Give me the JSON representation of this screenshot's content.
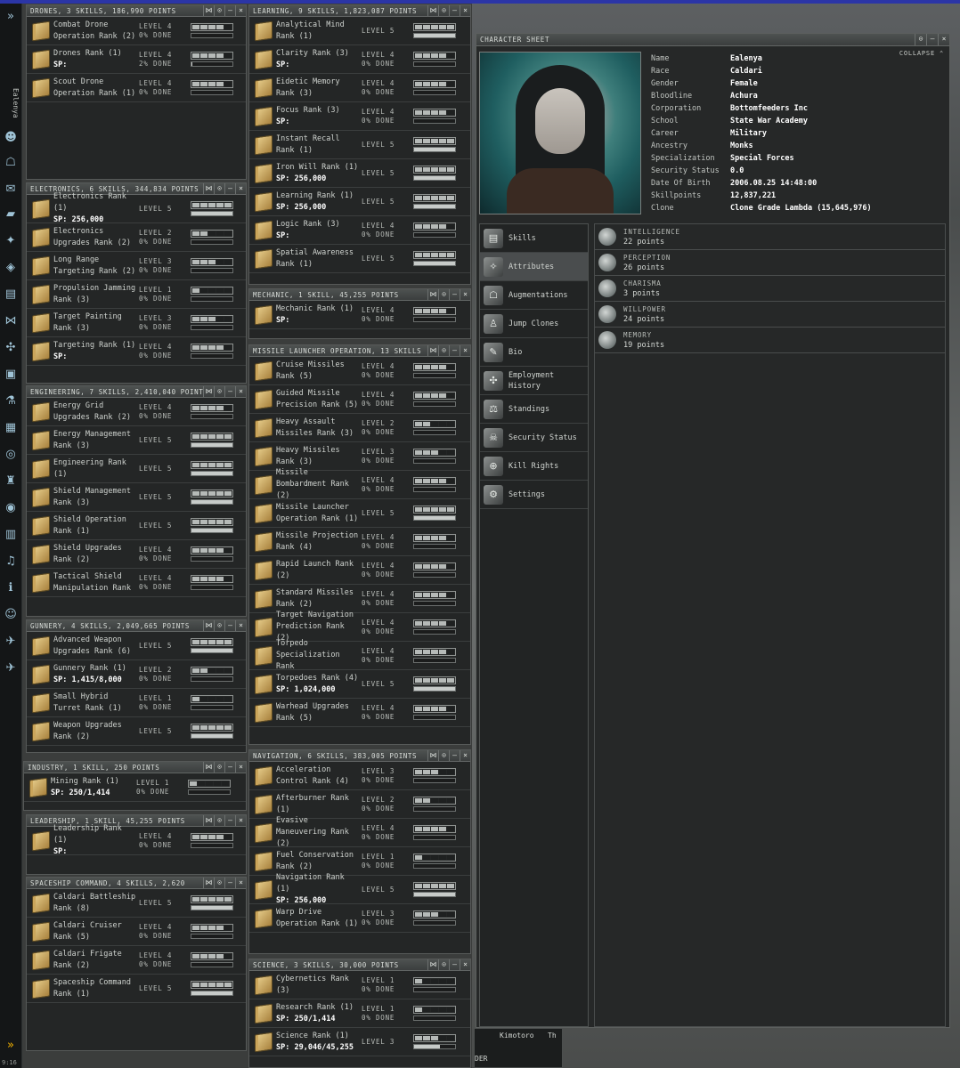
{
  "neocom": {
    "character": "Ealenya",
    "clock": "9:16"
  },
  "panels": [
    {
      "id": "drones",
      "title": "DRONES, 3 SKILLS, 186,990 POINTS",
      "skills": [
        {
          "name": "Combat Drone Operation Rank (2)",
          "level": "LEVEL 4",
          "done": "0% DONE",
          "lvl": 4,
          "pct": 0
        },
        {
          "name": "Drones Rank (1)",
          "sp": "SP:",
          "level": "LEVEL 4",
          "done": "2% DONE",
          "lvl": 4,
          "pct": 2
        },
        {
          "name": "Scout Drone Operation Rank (1)",
          "level": "LEVEL 4",
          "done": "0% DONE",
          "lvl": 4,
          "pct": 0
        }
      ]
    },
    {
      "id": "electronics",
      "title": "ELECTRONICS, 6 SKILLS, 344,834 POINTS",
      "skills": [
        {
          "name": "Electronics Rank (1)",
          "sp": "SP: 256,000",
          "level": "LEVEL 5",
          "lvl": 5,
          "pct": 100
        },
        {
          "name": "Electronics Upgrades Rank (2)",
          "level": "LEVEL 2",
          "done": "0% DONE",
          "lvl": 2,
          "pct": 0
        },
        {
          "name": "Long Range Targeting Rank (2)",
          "level": "LEVEL 3",
          "done": "0% DONE",
          "lvl": 3,
          "pct": 0
        },
        {
          "name": "Propulsion Jamming Rank (3)",
          "level": "LEVEL 1",
          "done": "0% DONE",
          "lvl": 1,
          "pct": 0
        },
        {
          "name": "Target Painting Rank (3)",
          "level": "LEVEL 3",
          "done": "0% DONE",
          "lvl": 3,
          "pct": 0
        },
        {
          "name": "Targeting Rank (1)",
          "sp": "SP:",
          "level": "LEVEL 4",
          "done": "0% DONE",
          "lvl": 4,
          "pct": 0
        }
      ]
    },
    {
      "id": "engineering",
      "title": "ENGINEERING, 7 SKILLS, 2,410,040 POINTS",
      "skills": [
        {
          "name": "Energy Grid Upgrades Rank (2)",
          "level": "LEVEL 4",
          "done": "0% DONE",
          "lvl": 4,
          "pct": 0
        },
        {
          "name": "Energy Management Rank (3)",
          "level": "LEVEL 5",
          "lvl": 5,
          "pct": 100
        },
        {
          "name": "Engineering Rank (1)",
          "level": "LEVEL 5",
          "lvl": 5,
          "pct": 100
        },
        {
          "name": "Shield Management Rank (3)",
          "level": "LEVEL 5",
          "lvl": 5,
          "pct": 100
        },
        {
          "name": "Shield Operation Rank (1)",
          "level": "LEVEL 5",
          "lvl": 5,
          "pct": 100
        },
        {
          "name": "Shield Upgrades Rank (2)",
          "level": "LEVEL 4",
          "done": "0% DONE",
          "lvl": 4,
          "pct": 0
        },
        {
          "name": "Tactical Shield Manipulation Rank",
          "level": "LEVEL 4",
          "done": "0% DONE",
          "lvl": 4,
          "pct": 0
        }
      ]
    },
    {
      "id": "gunnery",
      "title": "GUNNERY, 4 SKILLS, 2,049,665 POINTS",
      "skills": [
        {
          "name": "Advanced Weapon Upgrades Rank (6)",
          "level": "LEVEL 5",
          "lvl": 5,
          "pct": 100
        },
        {
          "name": "Gunnery Rank (1)",
          "sp": "SP: 1,415/8,000",
          "level": "LEVEL 2",
          "done": "0% DONE",
          "lvl": 2,
          "pct": 0
        },
        {
          "name": "Small Hybrid Turret Rank (1)",
          "level": "LEVEL 1",
          "done": "0% DONE",
          "lvl": 1,
          "pct": 0
        },
        {
          "name": "Weapon Upgrades Rank (2)",
          "level": "LEVEL 5",
          "lvl": 5,
          "pct": 100
        }
      ]
    },
    {
      "id": "industry",
      "title": "INDUSTRY, 1 SKILL, 250 POINTS",
      "skills": [
        {
          "name": "Mining Rank (1)",
          "sp": "SP: 250/1,414",
          "level": "LEVEL 1",
          "done": "0% DONE",
          "lvl": 1,
          "pct": 0
        }
      ]
    },
    {
      "id": "leadership",
      "title": "LEADERSHIP, 1 SKILL, 45,255 POINTS",
      "skills": [
        {
          "name": "Leadership Rank (1)",
          "sp": "SP:",
          "level": "LEVEL 4",
          "done": "0% DONE",
          "lvl": 4,
          "pct": 0
        }
      ]
    },
    {
      "id": "spaceship",
      "title": "SPACESHIP COMMAND, 4 SKILLS, 2,620",
      "skills": [
        {
          "name": "Caldari Battleship Rank (8)",
          "level": "LEVEL 5",
          "lvl": 5,
          "pct": 100
        },
        {
          "name": "Caldari Cruiser Rank (5)",
          "level": "LEVEL 4",
          "done": "0% DONE",
          "lvl": 4,
          "pct": 0
        },
        {
          "name": "Caldari Frigate Rank (2)",
          "level": "LEVEL 4",
          "done": "0% DONE",
          "lvl": 4,
          "pct": 0
        },
        {
          "name": "Spaceship Command Rank (1)",
          "level": "LEVEL 5",
          "lvl": 5,
          "pct": 100
        }
      ]
    },
    {
      "id": "learning",
      "title": "LEARNING, 9 SKILLS, 1,823,087 POINTS",
      "skills": [
        {
          "name": "Analytical Mind Rank (1)",
          "level": "LEVEL 5",
          "lvl": 5,
          "pct": 100
        },
        {
          "name": "Clarity Rank (3)",
          "sp": "SP:",
          "level": "LEVEL 4",
          "done": "0% DONE",
          "lvl": 4,
          "pct": 0
        },
        {
          "name": "Eidetic Memory Rank (3)",
          "level": "LEVEL 4",
          "done": "0% DONE",
          "lvl": 4,
          "pct": 0
        },
        {
          "name": "Focus Rank (3)",
          "sp": "SP:",
          "level": "LEVEL 4",
          "done": "0% DONE",
          "lvl": 4,
          "pct": 0
        },
        {
          "name": "Instant Recall Rank (1)",
          "level": "LEVEL 5",
          "lvl": 5,
          "pct": 100
        },
        {
          "name": "Iron Will Rank (1)",
          "sp": "SP: 256,000",
          "level": "LEVEL 5",
          "lvl": 5,
          "pct": 100
        },
        {
          "name": "Learning Rank (1)",
          "sp": "SP: 256,000",
          "level": "LEVEL 5",
          "lvl": 5,
          "pct": 100
        },
        {
          "name": "Logic Rank (3)",
          "sp": "SP:",
          "level": "LEVEL 4",
          "done": "0% DONE",
          "lvl": 4,
          "pct": 0
        },
        {
          "name": "Spatial Awareness Rank (1)",
          "level": "LEVEL 5",
          "lvl": 5,
          "pct": 100
        }
      ]
    },
    {
      "id": "mechanic",
      "title": "MECHANIC, 1 SKILL, 45,255 POINTS",
      "skills": [
        {
          "name": "Mechanic Rank (1)",
          "sp": "SP:",
          "level": "LEVEL 4",
          "done": "0% DONE",
          "lvl": 4,
          "pct": 0
        }
      ]
    },
    {
      "id": "missile",
      "title": "MISSILE LAUNCHER OPERATION, 13 SKILLS",
      "skills": [
        {
          "name": "Cruise Missiles Rank (5)",
          "level": "LEVEL 4",
          "done": "0% DONE",
          "lvl": 4,
          "pct": 0
        },
        {
          "name": "Guided Missile Precision Rank (5)",
          "level": "LEVEL 4",
          "done": "0% DONE",
          "lvl": 4,
          "pct": 0
        },
        {
          "name": "Heavy Assault Missiles Rank (3)",
          "level": "LEVEL 2",
          "done": "0% DONE",
          "lvl": 2,
          "pct": 0
        },
        {
          "name": "Heavy Missiles Rank (3)",
          "level": "LEVEL 3",
          "done": "0% DONE",
          "lvl": 3,
          "pct": 0
        },
        {
          "name": "Missile Bombardment Rank (2)",
          "level": "LEVEL 4",
          "done": "0% DONE",
          "lvl": 4,
          "pct": 0
        },
        {
          "name": "Missile Launcher Operation Rank (1)",
          "level": "LEVEL 5",
          "lvl": 5,
          "pct": 100
        },
        {
          "name": "Missile Projection Rank (4)",
          "level": "LEVEL 4",
          "done": "0% DONE",
          "lvl": 4,
          "pct": 0
        },
        {
          "name": "Rapid Launch Rank (2)",
          "level": "LEVEL 4",
          "done": "0% DONE",
          "lvl": 4,
          "pct": 0
        },
        {
          "name": "Standard Missiles Rank (2)",
          "level": "LEVEL 4",
          "done": "0% DONE",
          "lvl": 4,
          "pct": 0
        },
        {
          "name": "Target Navigation Prediction Rank (2)",
          "level": "LEVEL 4",
          "done": "0% DONE",
          "lvl": 4,
          "pct": 0
        },
        {
          "name": "Torpedo Specialization Rank",
          "level": "LEVEL 4",
          "done": "0% DONE",
          "lvl": 4,
          "pct": 0
        },
        {
          "name": "Torpedoes Rank (4)",
          "sp": "SP: 1,024,000",
          "level": "LEVEL 5",
          "lvl": 5,
          "pct": 100
        },
        {
          "name": "Warhead Upgrades Rank (5)",
          "level": "LEVEL 4",
          "done": "0% DONE",
          "lvl": 4,
          "pct": 0
        }
      ]
    },
    {
      "id": "navigation",
      "title": "NAVIGATION, 6 SKILLS, 383,005 POINTS",
      "skills": [
        {
          "name": "Acceleration Control Rank (4)",
          "level": "LEVEL 3",
          "done": "0% DONE",
          "lvl": 3,
          "pct": 0
        },
        {
          "name": "Afterburner Rank (1)",
          "level": "LEVEL 2",
          "done": "0% DONE",
          "lvl": 2,
          "pct": 0
        },
        {
          "name": "Evasive Maneuvering Rank (2)",
          "level": "LEVEL 4",
          "done": "0% DONE",
          "lvl": 4,
          "pct": 0
        },
        {
          "name": "Fuel Conservation Rank (2)",
          "level": "LEVEL 1",
          "done": "0% DONE",
          "lvl": 1,
          "pct": 0
        },
        {
          "name": "Navigation Rank (1)",
          "sp": "SP: 256,000",
          "level": "LEVEL 5",
          "lvl": 5,
          "pct": 100
        },
        {
          "name": "Warp Drive Operation Rank (1)",
          "level": "LEVEL 3",
          "done": "0% DONE",
          "lvl": 3,
          "pct": 0
        }
      ]
    },
    {
      "id": "science",
      "title": "SCIENCE, 3 SKILLS, 30,000 POINTS",
      "skills": [
        {
          "name": "Cybernetics Rank (3)",
          "level": "LEVEL 1",
          "done": "0% DONE",
          "lvl": 1,
          "pct": 0
        },
        {
          "name": "Research Rank (1)",
          "sp": "SP: 250/1,414",
          "level": "LEVEL 1",
          "done": "0% DONE",
          "lvl": 1,
          "pct": 0
        },
        {
          "name": "Science Rank (1)",
          "sp": "SP: 29,046/45,255",
          "level": "LEVEL 3",
          "lvl": 3,
          "pct": 64
        }
      ]
    }
  ],
  "character_sheet": {
    "title": "CHARACTER SHEET",
    "collapse": "COLLAPSE",
    "fields": [
      {
        "k": "Name",
        "v": "Ealenya"
      },
      {
        "k": "Race",
        "v": "Caldari"
      },
      {
        "k": "Gender",
        "v": "Female"
      },
      {
        "k": "Bloodline",
        "v": "Achura"
      },
      {
        "k": "Corporation",
        "v": "Bottomfeeders Inc"
      },
      {
        "k": "School",
        "v": "State War Academy"
      },
      {
        "k": "Career",
        "v": "Military"
      },
      {
        "k": "Ancestry",
        "v": "Monks"
      },
      {
        "k": "Specialization",
        "v": "Special Forces"
      },
      {
        "k": "Security Status",
        "v": "0.0"
      },
      {
        "k": "Date Of Birth",
        "v": "2006.08.25 14:48:00"
      },
      {
        "k": "Skillpoints",
        "v": "12,837,221"
      },
      {
        "k": "Clone",
        "v": "Clone Grade Lambda (15,645,976)"
      }
    ],
    "nav": [
      {
        "label": "Skills",
        "icon": "book-icon"
      },
      {
        "label": "Attributes",
        "icon": "attributes-icon",
        "selected": true
      },
      {
        "label": "Augmentations",
        "icon": "implant-icon"
      },
      {
        "label": "Jump Clones",
        "icon": "clone-icon"
      },
      {
        "label": "Bio",
        "icon": "bio-icon"
      },
      {
        "label": "Employment History",
        "icon": "employment-icon"
      },
      {
        "label": "Standings",
        "icon": "standings-icon"
      },
      {
        "label": "Security Status",
        "icon": "security-icon"
      },
      {
        "label": "Kill Rights",
        "icon": "kill-rights-icon"
      },
      {
        "label": "Settings",
        "icon": "settings-icon"
      }
    ],
    "attributes": [
      {
        "name": "INTELLIGENCE",
        "value": "22 points"
      },
      {
        "name": "PERCEPTION",
        "value": "26 points"
      },
      {
        "name": "CHARISMA",
        "value": "3 points"
      },
      {
        "name": "WILLPOWER",
        "value": "24 points"
      },
      {
        "name": "MEMORY",
        "value": "19 points"
      }
    ]
  },
  "footer": {
    "channel": "Kimotoro",
    "tab": "Th",
    "partial": "DER"
  }
}
